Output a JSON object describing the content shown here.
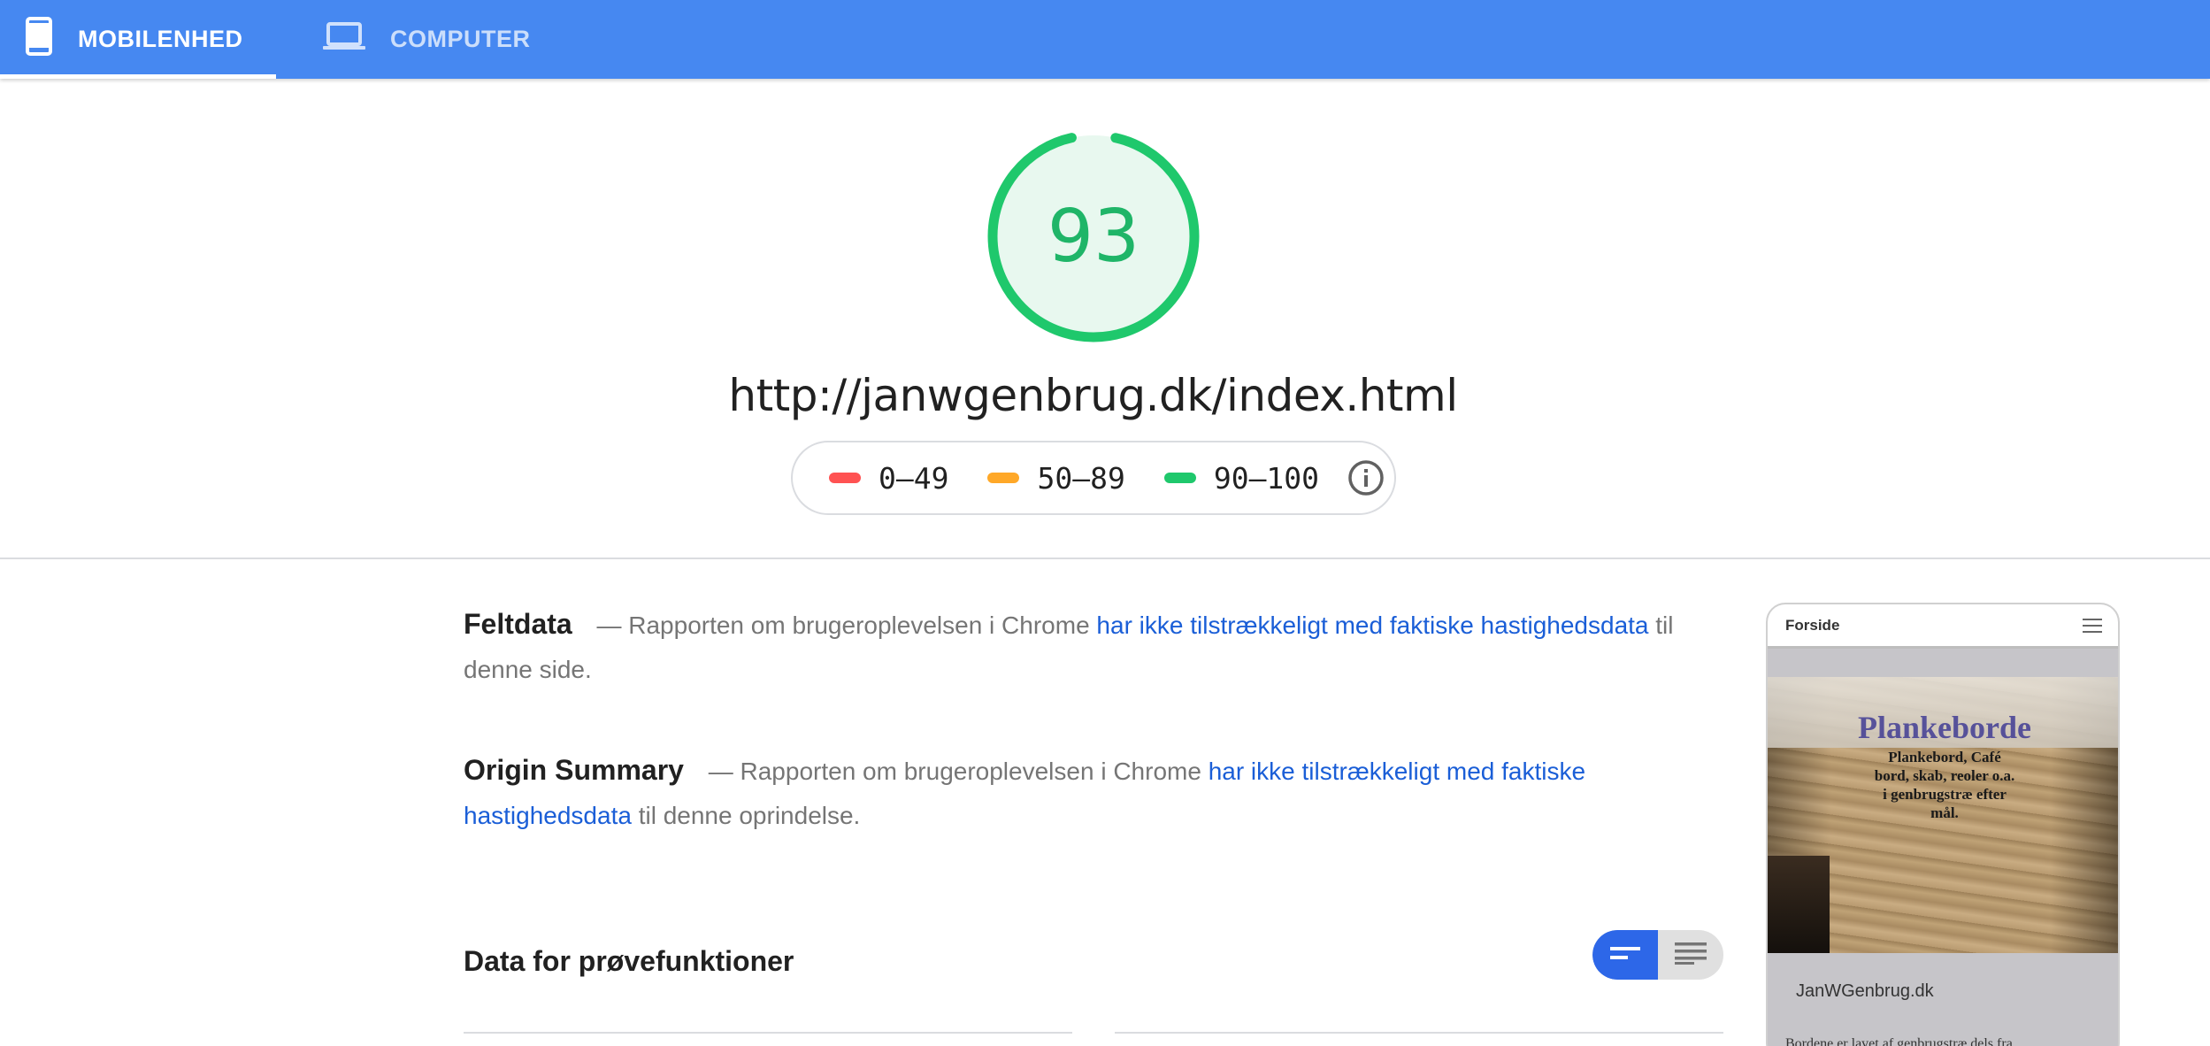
{
  "tabs": [
    {
      "label": "MOBILENHED",
      "icon": "smartphone-icon",
      "active": true
    },
    {
      "label": "COMPUTER",
      "icon": "laptop-icon",
      "active": false
    }
  ],
  "score": {
    "value": "93",
    "fraction": 0.93,
    "color": "#1fb568",
    "track_color": "#e8f8ef"
  },
  "url": "http://janwgenbrug.dk/index.html",
  "legend": [
    {
      "range": "0–49",
      "color": "#ff5252"
    },
    {
      "range": "50–89",
      "color": "#ffa828"
    },
    {
      "range": "90–100",
      "color": "#1fc86c"
    }
  ],
  "legend_info_icon": "info-icon",
  "field_data": {
    "title": "Feltdata",
    "dash": "—",
    "text_before": "Rapporten om brugeroplevelsen i Chrome",
    "link_text": "har ikke tilstrækkeligt med faktiske hastighedsdata",
    "text_after": "til denne side."
  },
  "origin_summary": {
    "title": "Origin Summary",
    "dash": "—",
    "text_before": "Rapporten om brugeroplevelsen i Chrome",
    "link_text": "har ikke tilstrækkeligt med faktiske hastighedsdata",
    "text_after": "til denne oprindelse."
  },
  "lab_data": {
    "title": "Data for prøvefunktioner"
  },
  "view_toggle": {
    "selected": "compact-view",
    "options": [
      "compact-view-icon",
      "list-view-icon"
    ],
    "accent": "#2d67e8"
  },
  "screenshot": {
    "nav_title": "Forside",
    "hero_heading": "Plankeborde",
    "hero_text": "Plankebord, Café\nbord, skab, reoler o.a.\ni genbrugstræ efter\nmål.",
    "brand": "JanWGenbrug.dk",
    "body_text": "Bordene er lavet af genbrugstræ dels fra"
  }
}
